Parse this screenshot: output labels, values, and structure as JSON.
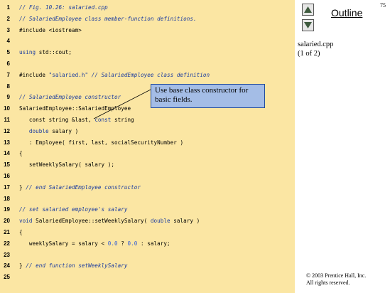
{
  "page_number": "75",
  "outline": {
    "title": "Outline",
    "up_icon": "triangle-up-icon",
    "down_icon": "triangle-down-icon",
    "file_name": "salaried.cpp",
    "part": "(1 of 2)"
  },
  "callout": {
    "text": "Use base class constructor for basic fields."
  },
  "copyright": {
    "line1": "© 2003 Prentice Hall, Inc.",
    "line2": "All rights reserved."
  },
  "code_lines": [
    {
      "num": "1",
      "segments": [
        {
          "t": "// Fig. 10.26: salaried.cpp",
          "c": "comment"
        }
      ]
    },
    {
      "num": "2",
      "segments": [
        {
          "t": "// SalariedEmployee class member-function definitions.",
          "c": "comment"
        }
      ]
    },
    {
      "num": "3",
      "segments": [
        {
          "t": "#include <iostream>",
          "c": "plain"
        }
      ]
    },
    {
      "num": "4",
      "segments": []
    },
    {
      "num": "5",
      "segments": [
        {
          "t": "using",
          "c": "kw"
        },
        {
          "t": " std::cout;",
          "c": "plain"
        }
      ]
    },
    {
      "num": "6",
      "segments": []
    },
    {
      "num": "7",
      "segments": [
        {
          "t": "#include ",
          "c": "plain"
        },
        {
          "t": "\"salaried.h\"",
          "c": "str"
        },
        {
          "t": " // SalariedEmployee class definition",
          "c": "comment"
        }
      ]
    },
    {
      "num": "8",
      "segments": []
    },
    {
      "num": "9",
      "segments": [
        {
          "t": "// SalariedEmployee constructor",
          "c": "comment"
        }
      ]
    },
    {
      "num": "10",
      "segments": [
        {
          "t": "SalariedEmployee::SalariedEmployee",
          "c": "plain"
        }
      ]
    },
    {
      "num": "11",
      "segments": [
        {
          "t": "   const string &last, ",
          "c": "plain"
        },
        {
          "t": "const",
          "c": "kw"
        },
        {
          "t": " string",
          "c": "plain"
        }
      ]
    },
    {
      "num": "12",
      "segments": [
        {
          "t": "   double",
          "c": "kw"
        },
        {
          "t": " salary )",
          "c": "plain"
        }
      ]
    },
    {
      "num": "13",
      "segments": [
        {
          "t": "   : Employee( first, last, socialSecurityNumber )",
          "c": "plain"
        }
      ]
    },
    {
      "num": "14",
      "segments": [
        {
          "t": "{",
          "c": "plain"
        }
      ]
    },
    {
      "num": "15",
      "segments": [
        {
          "t": "   setWeeklySalary( salary );",
          "c": "plain"
        }
      ]
    },
    {
      "num": "16",
      "segments": []
    },
    {
      "num": "17",
      "segments": [
        {
          "t": "} ",
          "c": "plain"
        },
        {
          "t": "// end SalariedEmployee constructor",
          "c": "comment"
        }
      ]
    },
    {
      "num": "18",
      "segments": []
    },
    {
      "num": "19",
      "segments": [
        {
          "t": "// set salaried employee's salary",
          "c": "comment"
        }
      ]
    },
    {
      "num": "20",
      "segments": [
        {
          "t": "void",
          "c": "kw"
        },
        {
          "t": " SalariedEmployee::setWeeklySalary( ",
          "c": "plain"
        },
        {
          "t": "double",
          "c": "kw"
        },
        {
          "t": " salary )",
          "c": "plain"
        }
      ]
    },
    {
      "num": "21",
      "segments": [
        {
          "t": "{",
          "c": "plain"
        }
      ]
    },
    {
      "num": "22",
      "segments": [
        {
          "t": "   weeklySalary = salary < ",
          "c": "plain"
        },
        {
          "t": "0.0",
          "c": "num"
        },
        {
          "t": " ? ",
          "c": "plain"
        },
        {
          "t": "0.0",
          "c": "num"
        },
        {
          "t": " : salary;",
          "c": "plain"
        }
      ]
    },
    {
      "num": "23",
      "segments": []
    },
    {
      "num": "24",
      "segments": [
        {
          "t": "} ",
          "c": "plain"
        },
        {
          "t": "// end function setWeeklySalary",
          "c": "comment"
        }
      ]
    },
    {
      "num": "25",
      "segments": []
    }
  ]
}
